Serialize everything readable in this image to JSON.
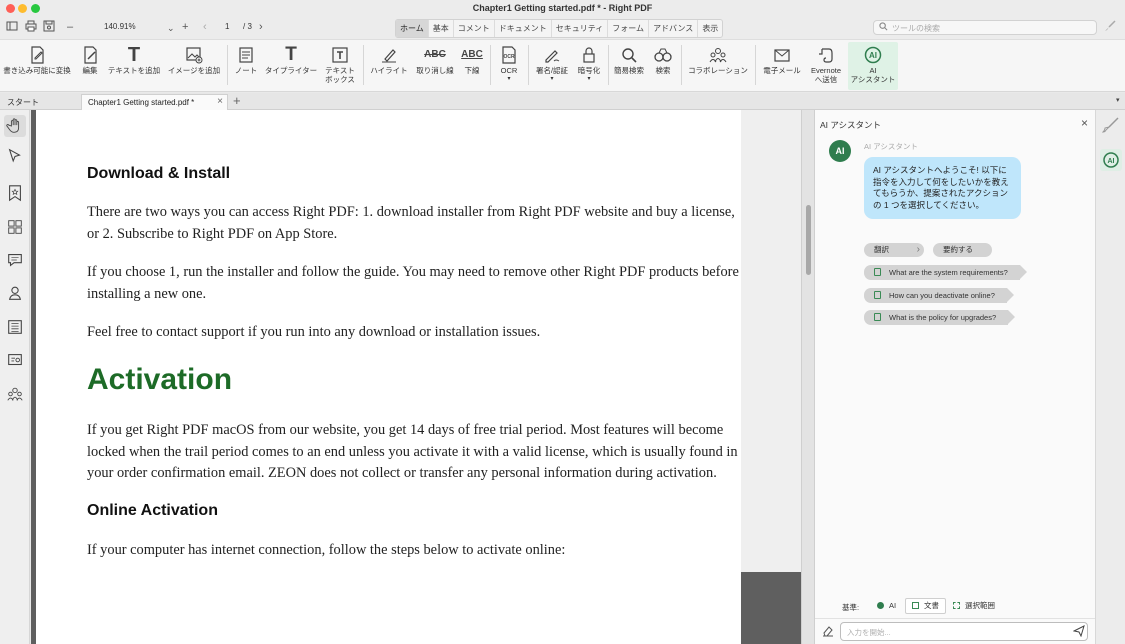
{
  "window": {
    "title": "Chapter1 Getting started.pdf * - Right PDF"
  },
  "nav": {
    "zoom": "140.91%",
    "page": "1",
    "page_total": "/ 3",
    "menu_tabs": [
      "ホーム",
      "基本",
      "コメント",
      "ドキュメント",
      "セキュリティ",
      "フォーム",
      "アドバンス",
      "表示"
    ],
    "active_menu": "ホーム",
    "search_placeholder": "ツールの検索"
  },
  "ribbon": {
    "items": [
      {
        "label": "書き込み可能に変換",
        "icon": "convert-editable-icon"
      },
      {
        "label": "編集",
        "icon": "edit-icon"
      },
      {
        "label": "テキストを追加",
        "icon": "add-text-icon"
      },
      {
        "label": "イメージを追加",
        "icon": "add-image-icon"
      },
      {
        "label": "ノート",
        "icon": "note-icon"
      },
      {
        "label": "タイプライター",
        "icon": "typewriter-icon"
      },
      {
        "label": "テキスト",
        "label2": "ボックス",
        "icon": "textbox-icon"
      },
      {
        "label": "ハイライト",
        "icon": "highlight-icon"
      },
      {
        "label": "取り消し線",
        "icon": "strikethrough-icon"
      },
      {
        "label": "下線",
        "icon": "underline-icon"
      },
      {
        "label": "OCR",
        "icon": "ocr-icon"
      },
      {
        "label": "署名/認証",
        "icon": "sign-icon"
      },
      {
        "label": "暗号化",
        "icon": "encrypt-icon"
      },
      {
        "label": "簡易検索",
        "icon": "quick-search-icon"
      },
      {
        "label": "検索",
        "icon": "advanced-search-icon"
      },
      {
        "label": "コラボレーション",
        "icon": "collaboration-icon"
      },
      {
        "label": "電子メール",
        "icon": "email-icon"
      },
      {
        "label": "Evernote",
        "label2": "へ送信",
        "icon": "evernote-icon"
      },
      {
        "label": "AI",
        "label2": "アシスタント",
        "icon": "ai-assistant-icon"
      }
    ]
  },
  "tabs": {
    "start": "スタート",
    "doc": "Chapter1 Getting started.pdf *"
  },
  "document": {
    "h_download": "Download & Install",
    "p1": "There are two ways you can access Right PDF: 1. download installer from Right PDF website and buy a license, or 2. Subscribe to Right PDF on App Store.",
    "p2": "If you choose 1, run the installer and follow the guide. You may need to remove other Right PDF products before installing a new one.",
    "p3": "Feel free to contact support if you run into any download or installation issues.",
    "h_activation": "Activation",
    "p4": "If you get Right PDF macOS from our website, you get 14 days of free trial period. Most features will become locked when the trail period comes to an end unless you activate it with a valid license, which is usually found in your order confirmation email. ZEON does not collect or transfer any personal information during activation.",
    "h_online": "Online Activation",
    "p5": "If your computer has internet connection, follow the steps below to activate online:",
    "heading_color": "#1d6b27"
  },
  "ai": {
    "title": "AI アシスタント",
    "sender": "AI アシスタント",
    "avatar_text": "AI",
    "welcome": "AI アシスタントへようこそ! 以下に指令を入力して何をしたいかを教えてもらうか、提案されたアクションの 1 つを選択してください。",
    "chip_translate": "翻訳",
    "chip_summarize": "要約する",
    "questions": [
      "What are the system requirements?",
      "How can you deactivate online?",
      "What is the policy for upgrades?"
    ],
    "basis_label": "基準:",
    "basis_options": [
      "AI",
      "文書",
      "選択範囲"
    ],
    "basis_selected": "文書",
    "input_placeholder": "入力を開始...",
    "accent": "#2f7d4e",
    "bubble_color": "#bfe6fb"
  }
}
